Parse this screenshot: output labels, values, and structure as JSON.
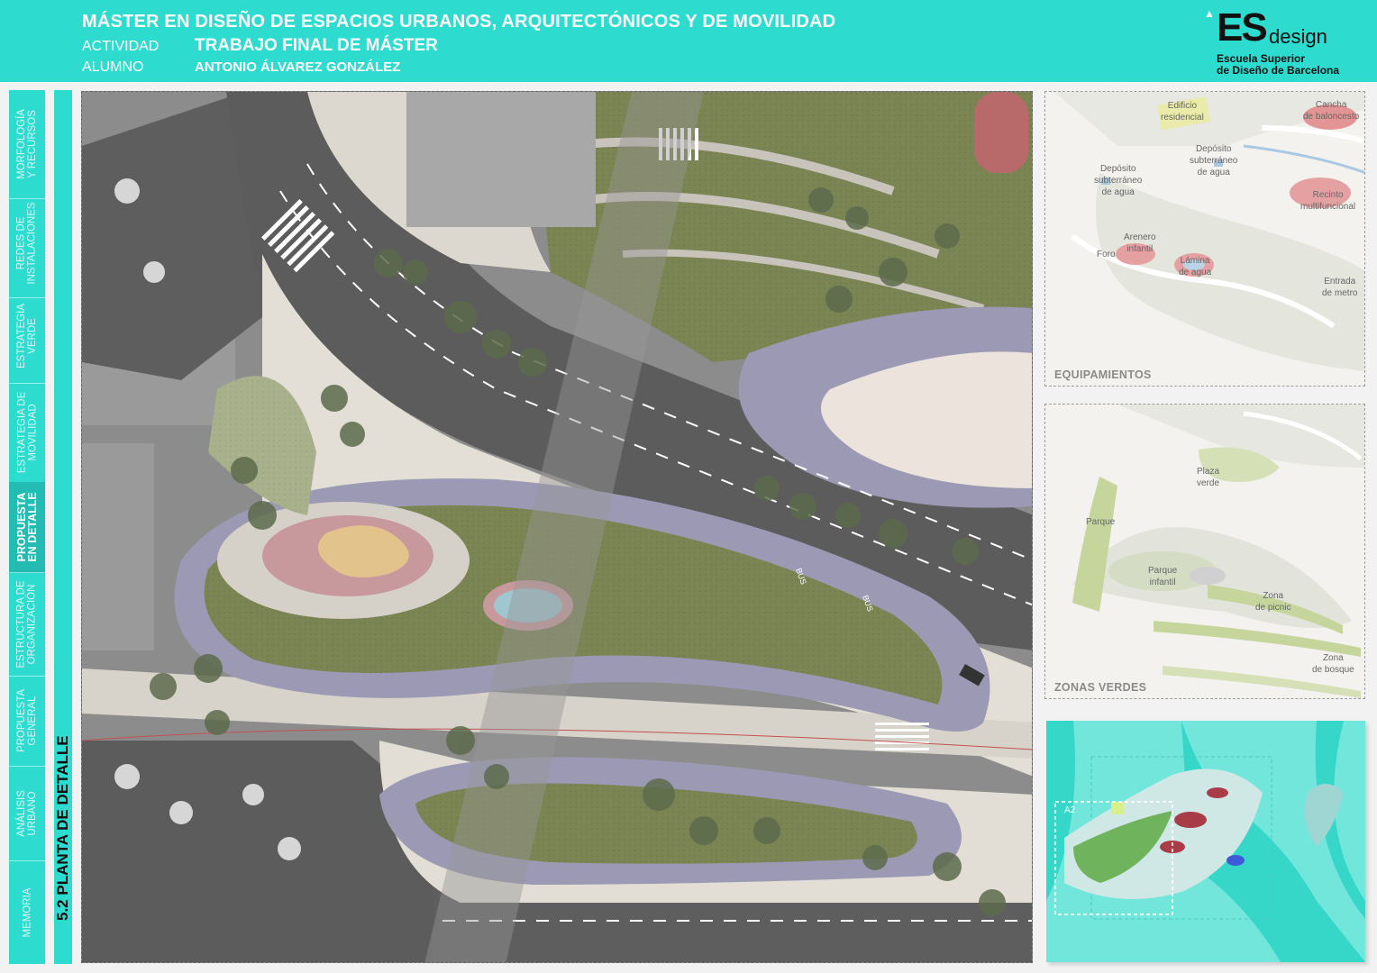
{
  "header": {
    "title": "MÁSTER EN DISEÑO DE ESPACIOS URBANOS, ARQUITECTÓNICOS Y DE MOVILIDAD",
    "activity_label": "ACTIVIDAD",
    "activity_value": "TRABAJO FINAL DE MÁSTER",
    "student_label": "ALUMNO",
    "student_value": "ANTONIO ÁLVAREZ GONZÁLEZ"
  },
  "logo": {
    "brand": "ES",
    "brand_suffix": "design",
    "line1": "Escuela Superior",
    "line2": "de Diseño de Barcelona"
  },
  "sidebar": {
    "items": [
      {
        "label_line1": "MORFOLOGÍA",
        "label_line2": "Y RECURSOS",
        "active": false
      },
      {
        "label_line1": "REDES DE",
        "label_line2": "INSTALACIONES",
        "active": false
      },
      {
        "label_line1": "ESTRATEGIA",
        "label_line2": "VERDE",
        "active": false
      },
      {
        "label_line1": "ESTRATEGIA DE",
        "label_line2": "MOVILIDAD",
        "active": false
      },
      {
        "label_line1": "PROPUESTA",
        "label_line2": "EN DETALLE",
        "active": true
      },
      {
        "label_line1": "ESTRUCTURA DE",
        "label_line2": "ORGANIZACIÓN",
        "active": false
      },
      {
        "label_line1": "PROPUESTA",
        "label_line2": "GENERAL",
        "active": false
      },
      {
        "label_line1": "ANÁLISIS",
        "label_line2": "URBANO",
        "active": false
      },
      {
        "label_line1": "MEMORIA",
        "label_line2": "",
        "active": false
      }
    ]
  },
  "section_title": "5.2 PLANTA DE DETALLE",
  "plan": {
    "road_marking": "BUS"
  },
  "equipamientos": {
    "title": "EQUIPAMIENTOS",
    "labels": {
      "edificio": [
        "Edificio",
        "residencial"
      ],
      "cancha": [
        "Cancha",
        "de baloncesto"
      ],
      "deposito1": [
        "Depósito",
        "subterráneo",
        "de agua"
      ],
      "deposito2": [
        "Depósito",
        "subterráneo",
        "de agua"
      ],
      "recinto": [
        "Recinto",
        "multifuncional"
      ],
      "arenero": [
        "Arenero",
        "infantil"
      ],
      "foro": [
        "Foro"
      ],
      "lamina": [
        "Lámina",
        "de agua"
      ],
      "metro": [
        "Entrada",
        "de metro"
      ]
    }
  },
  "zonas_verdes": {
    "title": "ZONAS VERDES",
    "labels": {
      "plaza": [
        "Plaza",
        "verde"
      ],
      "parque": [
        "Parque"
      ],
      "parque_infantil": [
        "Parque",
        "infantil"
      ],
      "picnic": [
        "Zona",
        "de picnic"
      ],
      "bosque": [
        "Zona",
        "de bosque"
      ]
    }
  },
  "keymap": {
    "area_label": "A2"
  },
  "colors": {
    "accent": "#2ddccf",
    "asphalt": "#5e5e5e",
    "paving": "#e4e0d8",
    "green": "#7d8756",
    "bike_lane": "#9a97b3"
  }
}
